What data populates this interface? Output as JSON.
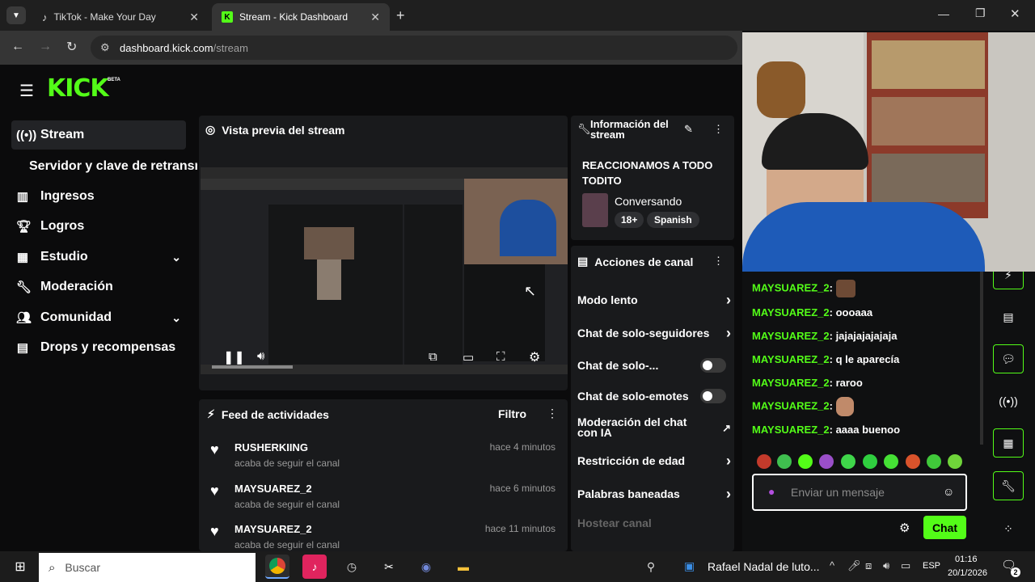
{
  "browser": {
    "tabs": [
      {
        "label": "TikTok - Make Your Day"
      },
      {
        "label": "Stream - Kick Dashboard"
      }
    ],
    "url_host": "dashboard.kick.com",
    "url_path": "/stream"
  },
  "brand": {
    "logo": "KICK",
    "badge": "BETA",
    "accent": "#53fc18"
  },
  "sidebar": {
    "items": [
      {
        "label": "Stream",
        "icon": "broadcast-icon"
      },
      {
        "label": "Servidor y clave de retransm"
      },
      {
        "label": "Ingresos",
        "icon": "chart-icon"
      },
      {
        "label": "Logros",
        "icon": "trophy-icon"
      },
      {
        "label": "Estudio",
        "icon": "studio-icon"
      },
      {
        "label": "Moderación",
        "icon": "wrench-icon"
      },
      {
        "label": "Comunidad",
        "icon": "community-icon"
      },
      {
        "label": "Drops y recompensas",
        "icon": "drops-icon"
      }
    ]
  },
  "preview": {
    "title": "Vista previa del stream"
  },
  "feed": {
    "title": "Feed de actividades",
    "filter": "Filtro",
    "rows": [
      {
        "user": "RUSHERKIING",
        "action": "acaba de seguir el canal",
        "time": "hace 4 minutos"
      },
      {
        "user": "MAYSUAREZ_2",
        "action": "acaba de seguir el canal",
        "time": "hace 6 minutos"
      },
      {
        "user": "MAYSUAREZ_2",
        "action": "acaba de seguir el canal",
        "time": "hace 11 minutos"
      }
    ]
  },
  "info": {
    "title": "Información del stream",
    "stream_title": "REACCIONAMOS A TODO TODITO",
    "category": "Conversando",
    "tags": [
      "18+",
      "Spanish"
    ]
  },
  "actions": {
    "title": "Acciones de canal",
    "items": [
      {
        "label": "Modo lento"
      },
      {
        "label": "Chat de solo-seguidores"
      },
      {
        "label": "Chat de solo-..."
      },
      {
        "label": "Chat de solo-emotes"
      },
      {
        "label": "Moderación del chat con IA"
      },
      {
        "label": "Restricción de edad"
      },
      {
        "label": "Palabras baneadas"
      },
      {
        "label": "Hostear canal"
      }
    ]
  },
  "chat": {
    "messages": [
      {
        "user": "MAYSUAREZ_2",
        "text": ""
      },
      {
        "user": "MAYSUAREZ_2",
        "text": "oooaaa"
      },
      {
        "user": "MAYSUAREZ_2",
        "text": "jajajajajajaja"
      },
      {
        "user": "MAYSUAREZ_2",
        "text": "q le aparecía"
      },
      {
        "user": "MAYSUAREZ_2",
        "text": "raroo"
      },
      {
        "user": "MAYSUAREZ_2",
        "text": ""
      },
      {
        "user": "MAYSUAREZ_2",
        "text": "aaaa buenoo"
      }
    ],
    "input_placeholder": "Enviar un mensaje",
    "send_label": "Chat"
  },
  "taskbar": {
    "search_placeholder": "Buscar",
    "news": "Rafael Nadal de luto...",
    "lang": "ESP",
    "time": "01:16",
    "date": "20/1/2026",
    "notif_count": "2"
  }
}
